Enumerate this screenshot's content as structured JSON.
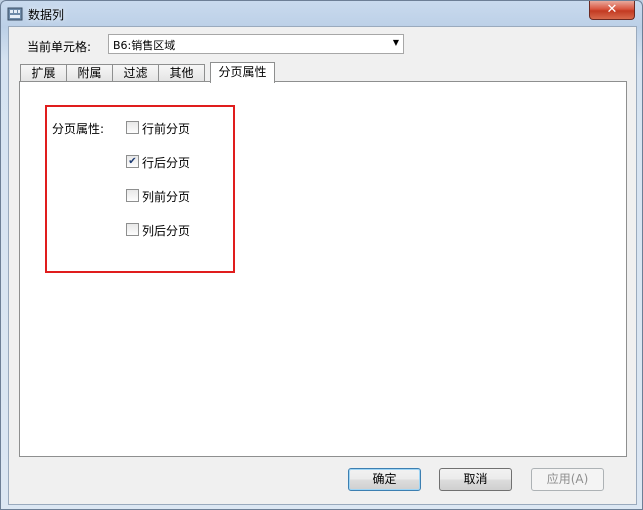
{
  "window": {
    "title": "数据列",
    "close_label": "✕"
  },
  "cell": {
    "label": "当前单元格:",
    "value": "B6:销售区域"
  },
  "tabs": [
    {
      "label": "扩展",
      "active": false
    },
    {
      "label": "附属",
      "active": false
    },
    {
      "label": "过滤",
      "active": false
    },
    {
      "label": "其他",
      "active": false
    },
    {
      "label": "分页属性",
      "active": true
    }
  ],
  "paging": {
    "label": "分页属性:",
    "options": [
      {
        "label": "行前分页",
        "checked": false
      },
      {
        "label": "行后分页",
        "checked": true
      },
      {
        "label": "列前分页",
        "checked": false
      },
      {
        "label": "列后分页",
        "checked": false
      }
    ]
  },
  "buttons": {
    "ok": "确定",
    "cancel": "取消",
    "apply": "应用(A)"
  },
  "colors": {
    "highlight": "#e01d1d",
    "title_bar": "#bcd0e7"
  }
}
